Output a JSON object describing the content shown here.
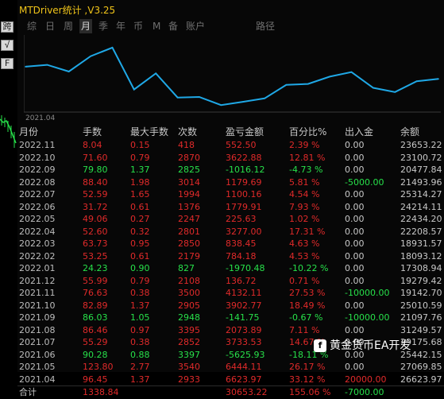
{
  "window": {
    "title": "MTDriver统计 ,V3.25"
  },
  "side_buttons": [
    "跨",
    "√",
    "F"
  ],
  "toolbar": {
    "items": [
      {
        "label": "综",
        "active": false
      },
      {
        "label": "日",
        "active": false
      },
      {
        "label": "周",
        "active": false
      },
      {
        "label": "月",
        "active": true
      },
      {
        "label": "季",
        "active": false
      },
      {
        "label": "年",
        "active": false
      },
      {
        "label": "币",
        "active": false
      },
      {
        "label": "M",
        "active": false
      },
      {
        "label": "备",
        "active": false
      },
      {
        "label": "账户",
        "active": false
      },
      {
        "label": "路径",
        "active": false
      }
    ]
  },
  "chart_data": {
    "type": "line",
    "x": [
      "2021.04",
      "2021.05",
      "2021.06",
      "2021.07",
      "2021.08",
      "2021.09",
      "2021.10",
      "2021.11",
      "2021.12",
      "2022.01",
      "2022.02",
      "2022.03",
      "2022.04",
      "2022.05",
      "2022.06",
      "2022.07",
      "2022.08",
      "2022.09",
      "2022.10",
      "2022.11"
    ],
    "y": [
      26623.97,
      27069.85,
      25442.15,
      29175.68,
      31249.57,
      21097.76,
      25010.59,
      19142.7,
      19279.42,
      17308.94,
      18093.12,
      18931.57,
      22208.57,
      22434.2,
      24214.11,
      25314.27,
      21493.96,
      20477.84,
      23100.72,
      23653.22
    ],
    "xlabel_start": "2021.04",
    "color": "#1fa8e6"
  },
  "table": {
    "headers": [
      "月份",
      "手数",
      "最大手数",
      "次数",
      "盈亏金额",
      "百分比%",
      "出入金",
      "余额"
    ],
    "rows": [
      {
        "month": "2022.11",
        "lots": "8.04",
        "max": "0.15",
        "count": "418",
        "pnl": "552.50",
        "pct": "2.39 %",
        "flow": "0.00",
        "bal": "23653.22",
        "sign": "neg"
      },
      {
        "month": "2022.10",
        "lots": "71.60",
        "max": "0.79",
        "count": "2870",
        "pnl": "3622.88",
        "pct": "12.81 %",
        "flow": "0.00",
        "bal": "23100.72",
        "sign": "neg"
      },
      {
        "month": "2022.09",
        "lots": "79.80",
        "max": "1.37",
        "count": "2825",
        "pnl": "-1016.12",
        "pct": "-4.73 %",
        "flow": "0.00",
        "bal": "20477.84",
        "sign": "pos"
      },
      {
        "month": "2022.08",
        "lots": "88.40",
        "max": "1.98",
        "count": "3014",
        "pnl": "1179.69",
        "pct": "5.81 %",
        "flow": "-5000.00",
        "bal": "21493.96",
        "sign": "neg"
      },
      {
        "month": "2022.07",
        "lots": "52.59",
        "max": "1.65",
        "count": "1994",
        "pnl": "1100.16",
        "pct": "4.54 %",
        "flow": "0.00",
        "bal": "25314.27",
        "sign": "neg"
      },
      {
        "month": "2022.06",
        "lots": "31.72",
        "max": "0.61",
        "count": "1376",
        "pnl": "1779.91",
        "pct": "7.93 %",
        "flow": "0.00",
        "bal": "24214.11",
        "sign": "neg"
      },
      {
        "month": "2022.05",
        "lots": "49.06",
        "max": "0.27",
        "count": "2247",
        "pnl": "225.63",
        "pct": "1.02 %",
        "flow": "0.00",
        "bal": "22434.20",
        "sign": "neg"
      },
      {
        "month": "2022.04",
        "lots": "52.60",
        "max": "0.32",
        "count": "2801",
        "pnl": "3277.00",
        "pct": "17.31 %",
        "flow": "0.00",
        "bal": "22208.57",
        "sign": "neg"
      },
      {
        "month": "2022.03",
        "lots": "63.73",
        "max": "0.95",
        "count": "2850",
        "pnl": "838.45",
        "pct": "4.63 %",
        "flow": "0.00",
        "bal": "18931.57",
        "sign": "neg"
      },
      {
        "month": "2022.02",
        "lots": "53.25",
        "max": "0.61",
        "count": "2179",
        "pnl": "784.18",
        "pct": "4.53 %",
        "flow": "0.00",
        "bal": "18093.12",
        "sign": "neg"
      },
      {
        "month": "2022.01",
        "lots": "24.23",
        "max": "0.90",
        "count": "827",
        "pnl": "-1970.48",
        "pct": "-10.22 %",
        "flow": "0.00",
        "bal": "17308.94",
        "sign": "pos"
      },
      {
        "month": "2021.12",
        "lots": "55.99",
        "max": "0.79",
        "count": "2108",
        "pnl": "136.72",
        "pct": "0.71 %",
        "flow": "0.00",
        "bal": "19279.42",
        "sign": "neg"
      },
      {
        "month": "2021.11",
        "lots": "76.63",
        "max": "0.38",
        "count": "3500",
        "pnl": "4132.11",
        "pct": "27.53 %",
        "flow": "-10000.00",
        "bal": "19142.70",
        "sign": "neg"
      },
      {
        "month": "2021.10",
        "lots": "82.89",
        "max": "1.37",
        "count": "2905",
        "pnl": "3902.77",
        "pct": "18.49 %",
        "flow": "0.00",
        "bal": "25010.59",
        "sign": "neg"
      },
      {
        "month": "2021.09",
        "lots": "86.03",
        "max": "1.05",
        "count": "2948",
        "pnl": "-141.75",
        "pct": "-0.67 %",
        "flow": "-10000.00",
        "bal": "21097.76",
        "sign": "pos"
      },
      {
        "month": "2021.08",
        "lots": "86.46",
        "max": "0.97",
        "count": "3395",
        "pnl": "2073.89",
        "pct": "7.11 %",
        "flow": "0.00",
        "bal": "31249.57",
        "sign": "neg"
      },
      {
        "month": "2021.07",
        "lots": "55.29",
        "max": "0.38",
        "count": "2852",
        "pnl": "3733.53",
        "pct": "14.67 %",
        "flow": "0.00",
        "bal": "29175.68",
        "sign": "neg"
      },
      {
        "month": "2021.06",
        "lots": "90.28",
        "max": "0.88",
        "count": "3397",
        "pnl": "-5625.93",
        "pct": "-18.11 %",
        "flow": "0.00",
        "bal": "25442.15",
        "sign": "pos"
      },
      {
        "month": "2021.05",
        "lots": "123.80",
        "max": "2.77",
        "count": "3540",
        "pnl": "6444.11",
        "pct": "26.17 %",
        "flow": "0.00",
        "bal": "27069.85",
        "sign": "neg"
      },
      {
        "month": "2021.04",
        "lots": "96.45",
        "max": "1.37",
        "count": "2933",
        "pnl": "6623.97",
        "pct": "33.12 %",
        "flow": "20000.00",
        "bal": "26623.97",
        "sign": "neg"
      }
    ],
    "total": {
      "label": "合计",
      "lots": "1338.84",
      "pnl": "30653.22",
      "pct": "155.06 %",
      "flow": "-7000.00"
    }
  },
  "watermark": {
    "text": "黄金货币EA开发"
  },
  "colors": {
    "positive": "#27e04a",
    "negative": "#e02a2a",
    "title": "#f0c419",
    "line": "#1fa8e6"
  }
}
